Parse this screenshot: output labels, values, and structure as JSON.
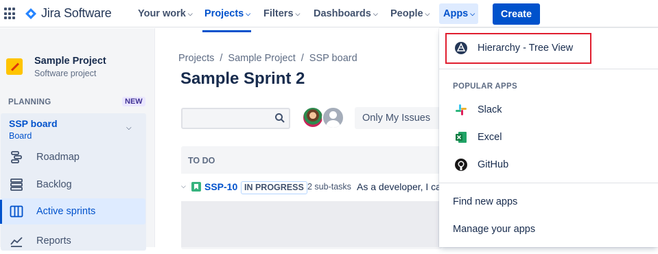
{
  "brand": {
    "name": "Jira Software"
  },
  "topnav": {
    "your_work": "Your work",
    "projects": "Projects",
    "filters": "Filters",
    "dashboards": "Dashboards",
    "people": "People",
    "apps": "Apps",
    "create": "Create"
  },
  "sidebar": {
    "project_name": "Sample Project",
    "project_type": "Software project",
    "section": "PLANNING",
    "new_badge": "NEW",
    "board_name": "SSP board",
    "board_sub": "Board",
    "items": [
      {
        "label": "Roadmap",
        "icon": "roadmap-icon"
      },
      {
        "label": "Backlog",
        "icon": "backlog-icon"
      },
      {
        "label": "Active sprints",
        "icon": "active-sprints-icon",
        "active": true
      },
      {
        "label": "Reports",
        "icon": "reports-icon"
      }
    ]
  },
  "breadcrumb": [
    "Projects",
    "/",
    "Sample Project",
    "/",
    "SSP board"
  ],
  "page_title": "Sample Sprint 2",
  "toolbar": {
    "search_value": "",
    "only_my_issues": "Only My Issues"
  },
  "board": {
    "column": "TO DO",
    "issue": {
      "key": "SSP-10",
      "status": "IN PROGRESS",
      "subtasks": "2 sub-tasks",
      "summary": "As a developer, I ca"
    }
  },
  "apps_menu": {
    "highlighted": {
      "label": "Hierarchy - Tree View",
      "icon": "hierarchy-app-icon"
    },
    "popular_heading": "POPULAR APPS",
    "popular": [
      {
        "label": "Slack",
        "icon": "slack-icon"
      },
      {
        "label": "Excel",
        "icon": "excel-icon"
      },
      {
        "label": "GitHub",
        "icon": "github-icon"
      }
    ],
    "find_new": "Find new apps",
    "manage": "Manage your apps"
  },
  "colors": {
    "brand_blue": "#0052CC",
    "highlight_red": "#E01E2F",
    "sidebar_bg": "#F4F5F7"
  }
}
